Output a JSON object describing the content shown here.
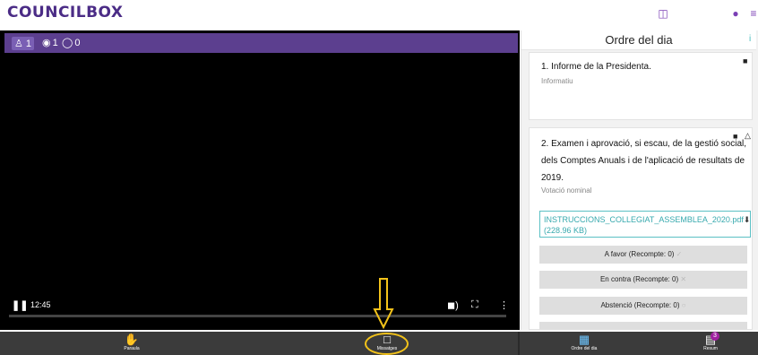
{
  "app": {
    "logo": "COUNCILBOX"
  },
  "topbar": {
    "icons": [
      "book-icon",
      "user-icon",
      "menu-icon"
    ]
  },
  "video": {
    "header": {
      "participants": "1",
      "online": "1",
      "viewers": "0"
    },
    "time": "12:45",
    "progress_fraction": 0.0
  },
  "agenda": {
    "title": "Ordre del dia",
    "items": [
      {
        "title": "1. Informe de la Presidenta.",
        "type": "Informatiu"
      },
      {
        "title_lines": [
          "2. Examen i aprovació, si escau, de la gestió social,",
          "dels Comptes Anuals i de l'aplicació de resultats de",
          "2019."
        ],
        "type": "Votació nominal",
        "file": {
          "name": "INSTRUCCIONS_COLLEGIAT_ASSEMBLEA_2020.pdf",
          "size": "(228.96 KB)"
        },
        "vote_options": [
          "A favor (Recompte: 0)",
          "En contra (Recompte: 0)",
          "Abstenció (Recompte: 0)"
        ]
      }
    ]
  },
  "bottom": {
    "left": [
      {
        "label": "Paraula",
        "icon": "hand-icon"
      },
      {
        "label": "Missatges",
        "icon": "message-icon"
      }
    ],
    "right": [
      {
        "label": "Ordre del dia",
        "icon": "calendar-icon"
      },
      {
        "label": "Resum",
        "icon": "document-icon",
        "badge": "3"
      }
    ]
  },
  "colors": {
    "brand": "#4b2c86",
    "header": "#5c3f8f",
    "accent": "#f2c21a",
    "file": "#37a9ae"
  }
}
